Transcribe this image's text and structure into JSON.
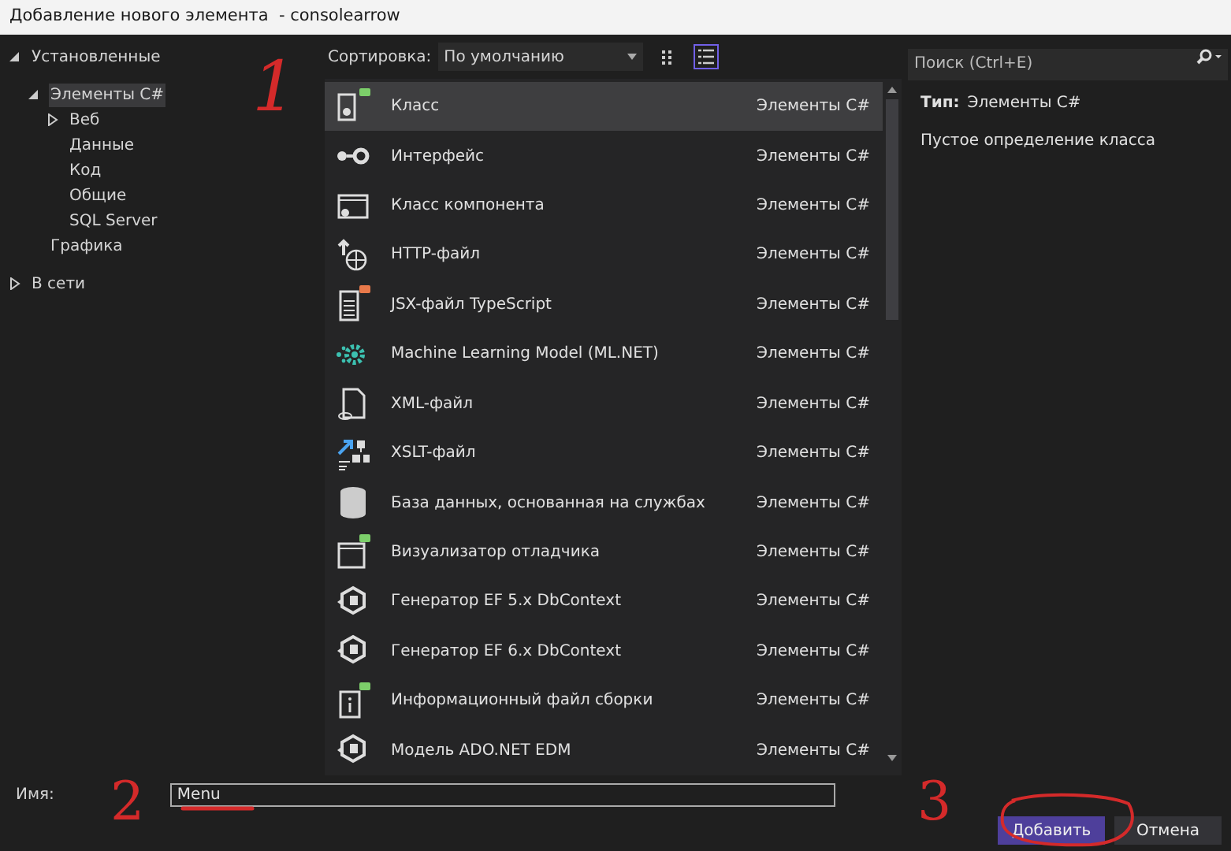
{
  "window": {
    "title": "Добавление нового элемента  - consolearrow"
  },
  "tree": [
    {
      "label": "Установленные",
      "expanded": true,
      "selected": false,
      "children": [
        {
          "label": "Элементы C#",
          "expanded": true,
          "selected": true,
          "children": [
            {
              "label": "Веб",
              "expanded": false,
              "selected": false
            },
            {
              "label": "Данные",
              "selected": false
            },
            {
              "label": "Код",
              "selected": false
            },
            {
              "label": "Общие",
              "selected": false
            },
            {
              "label": "SQL Server",
              "selected": false
            }
          ]
        },
        {
          "label": "Графика",
          "selected": false
        }
      ]
    },
    {
      "label": "В сети",
      "expanded": false,
      "selected": false
    }
  ],
  "toolbar": {
    "sort_label": "Сортировка:",
    "sort_value": "По умолчанию",
    "views": [
      {
        "kind": "grid",
        "selected": false
      },
      {
        "kind": "list",
        "selected": true
      }
    ]
  },
  "search": {
    "placeholder": "Поиск (Ctrl+E)"
  },
  "items": [
    {
      "name": "Класс",
      "category": "Элементы C#",
      "selected": true
    },
    {
      "name": "Интерфейс",
      "category": "Элементы C#",
      "selected": false
    },
    {
      "name": "Класс компонента",
      "category": "Элементы C#",
      "selected": false
    },
    {
      "name": "HTTP-файл",
      "category": "Элементы C#",
      "selected": false
    },
    {
      "name": "JSX-файл TypeScript",
      "category": "Элементы C#",
      "selected": false
    },
    {
      "name": "Machine Learning Model (ML.NET)",
      "category": "Элементы C#",
      "selected": false
    },
    {
      "name": "XML-файл",
      "category": "Элементы C#",
      "selected": false
    },
    {
      "name": "XSLT-файл",
      "category": "Элементы C#",
      "selected": false
    },
    {
      "name": "База данных, основанная на службах",
      "category": "Элементы C#",
      "selected": false
    },
    {
      "name": "Визуализатор отладчика",
      "category": "Элементы C#",
      "selected": false
    },
    {
      "name": "Генератор EF 5.x DbContext",
      "category": "Элементы C#",
      "selected": false
    },
    {
      "name": "Генератор EF 6.x DbContext",
      "category": "Элементы C#",
      "selected": false
    },
    {
      "name": "Информационный файл сборки",
      "category": "Элементы C#",
      "selected": false
    },
    {
      "name": "Модель ADO.NET EDM",
      "category": "Элементы C#",
      "selected": false
    }
  ],
  "details": {
    "type_label": "Тип:",
    "type_value": "Элементы C#",
    "description": "Пустое определение класса"
  },
  "name_field": {
    "label": "Имя:",
    "value": "Menu"
  },
  "buttons": [
    {
      "label": "Добавить",
      "kind": "primary"
    },
    {
      "label": "Отмена",
      "kind": "secondary"
    }
  ],
  "annotations": [
    "1",
    "2",
    "3"
  ]
}
